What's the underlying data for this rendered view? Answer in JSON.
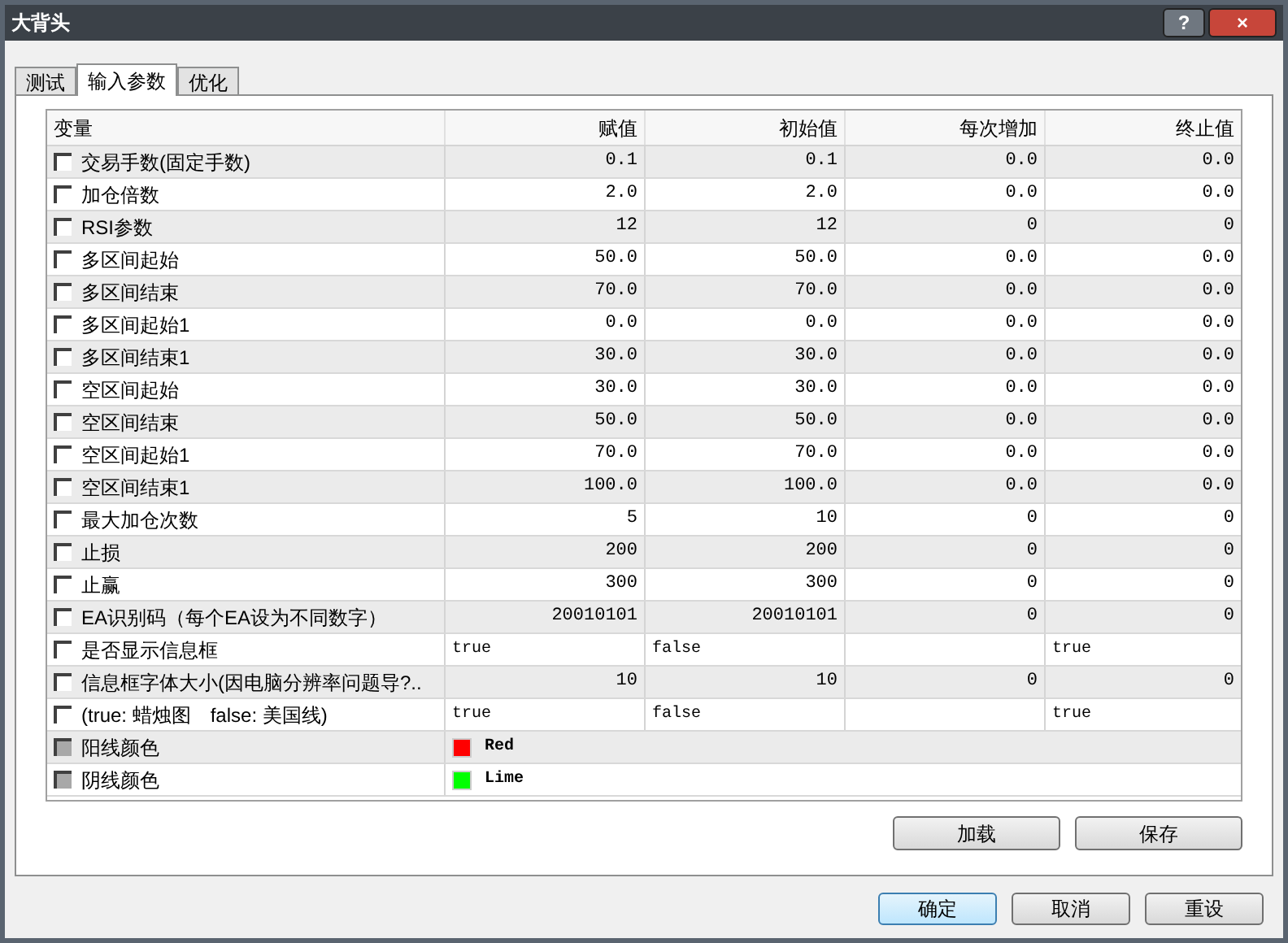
{
  "window": {
    "title": "大背头",
    "buttons": [
      {
        "kind": "help",
        "label": "?"
      },
      {
        "kind": "close",
        "label": "×"
      }
    ]
  },
  "tabs": [
    {
      "label": "测试",
      "selected": false
    },
    {
      "label": "输入参数",
      "selected": true
    },
    {
      "label": "优化",
      "selected": false
    }
  ],
  "table": {
    "columns": [
      "变量",
      "赋值",
      "初始值",
      "每次增加",
      "终止值"
    ],
    "rows": [
      {
        "kind": "number",
        "checked": false,
        "disabled": false,
        "cells": [
          "交易手数(固定手数)",
          "0.1",
          "0.1",
          "0.0",
          "0.0"
        ]
      },
      {
        "kind": "number",
        "checked": false,
        "disabled": false,
        "cells": [
          "加仓倍数",
          "2.0",
          "2.0",
          "0.0",
          "0.0"
        ]
      },
      {
        "kind": "number",
        "checked": false,
        "disabled": false,
        "cells": [
          "RSI参数",
          "12",
          "12",
          "0",
          "0"
        ]
      },
      {
        "kind": "number",
        "checked": false,
        "disabled": false,
        "cells": [
          "多区间起始",
          "50.0",
          "50.0",
          "0.0",
          "0.0"
        ]
      },
      {
        "kind": "number",
        "checked": false,
        "disabled": false,
        "cells": [
          "多区间结束",
          "70.0",
          "70.0",
          "0.0",
          "0.0"
        ]
      },
      {
        "kind": "number",
        "checked": false,
        "disabled": false,
        "cells": [
          "多区间起始1",
          "0.0",
          "0.0",
          "0.0",
          "0.0"
        ]
      },
      {
        "kind": "number",
        "checked": false,
        "disabled": false,
        "cells": [
          "多区间结束1",
          "30.0",
          "30.0",
          "0.0",
          "0.0"
        ]
      },
      {
        "kind": "number",
        "checked": false,
        "disabled": false,
        "cells": [
          "空区间起始",
          "30.0",
          "30.0",
          "0.0",
          "0.0"
        ]
      },
      {
        "kind": "number",
        "checked": false,
        "disabled": false,
        "cells": [
          "空区间结束",
          "50.0",
          "50.0",
          "0.0",
          "0.0"
        ]
      },
      {
        "kind": "number",
        "checked": false,
        "disabled": false,
        "cells": [
          "空区间起始1",
          "70.0",
          "70.0",
          "0.0",
          "0.0"
        ]
      },
      {
        "kind": "number",
        "checked": false,
        "disabled": false,
        "cells": [
          "空区间结束1",
          "100.0",
          "100.0",
          "0.0",
          "0.0"
        ]
      },
      {
        "kind": "number",
        "checked": false,
        "disabled": false,
        "cells": [
          "最大加仓次数",
          "5",
          "10",
          "0",
          "0"
        ]
      },
      {
        "kind": "number",
        "checked": false,
        "disabled": false,
        "cells": [
          "止损",
          "200",
          "200",
          "0",
          "0"
        ]
      },
      {
        "kind": "number",
        "checked": false,
        "disabled": false,
        "cells": [
          "止赢",
          "300",
          "300",
          "0",
          "0"
        ]
      },
      {
        "kind": "number",
        "checked": false,
        "disabled": false,
        "cells": [
          "EA识别码（每个EA设为不同数字）",
          "20010101",
          "20010101",
          "0",
          "0"
        ]
      },
      {
        "kind": "bool",
        "checked": false,
        "disabled": false,
        "cells": [
          "是否显示信息框",
          "true",
          "false",
          "",
          "true"
        ]
      },
      {
        "kind": "number",
        "checked": false,
        "disabled": false,
        "cells": [
          "信息框字体大小(因电脑分辨率问题导?..",
          "10",
          "10",
          "0",
          "0"
        ]
      },
      {
        "kind": "bool",
        "checked": false,
        "disabled": false,
        "cells": [
          "(true: 蜡烛图　false: 美国线)",
          "true",
          "false",
          "",
          "true"
        ]
      },
      {
        "kind": "color",
        "checked": false,
        "disabled": true,
        "color": "#ff0000",
        "cells": [
          "阳线颜色",
          "Red"
        ]
      },
      {
        "kind": "color",
        "checked": false,
        "disabled": true,
        "color": "#00ff00",
        "cells": [
          "阴线颜色",
          "Lime"
        ]
      }
    ]
  },
  "panel_buttons": [
    "加载",
    "保存"
  ],
  "dialog_buttons": [
    {
      "label": "确定",
      "default": true
    },
    {
      "label": "取消",
      "default": false
    },
    {
      "label": "重设",
      "default": false
    }
  ]
}
